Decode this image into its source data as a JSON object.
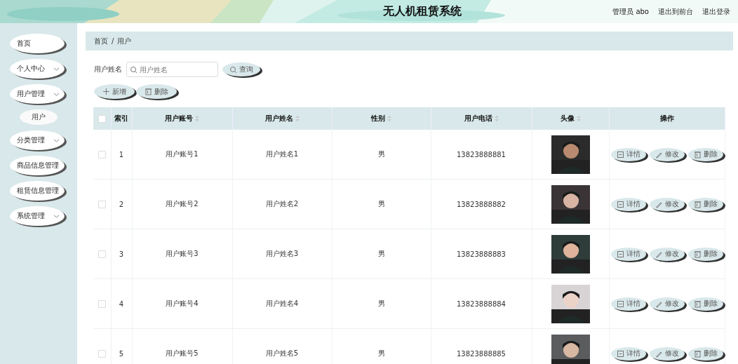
{
  "header": {
    "title": "无人机租赁系统",
    "links": [
      {
        "kind": "text",
        "label": "管理员 abo"
      },
      {
        "kind": "link",
        "label": "退出到前台"
      },
      {
        "kind": "link",
        "label": "退出登录"
      }
    ]
  },
  "sidebar": {
    "items": [
      {
        "label": "首页",
        "kind": "menu",
        "expandable": false,
        "selected": false
      },
      {
        "label": "个人中心",
        "kind": "menu",
        "expandable": true,
        "selected": false
      },
      {
        "label": "用户管理",
        "kind": "menu",
        "expandable": true,
        "selected": false
      },
      {
        "label": "用户",
        "kind": "submenu",
        "expandable": false,
        "selected": true
      },
      {
        "label": "分类管理",
        "kind": "menu",
        "expandable": true,
        "selected": false
      },
      {
        "label": "商品信息管理",
        "kind": "menu",
        "expandable": false,
        "selected": false
      },
      {
        "label": "租赁信息管理",
        "kind": "menu",
        "expandable": false,
        "selected": false
      },
      {
        "label": "系统管理",
        "kind": "menu",
        "expandable": true,
        "selected": false
      }
    ]
  },
  "breadcrumb": [
    "首页",
    "/",
    "用户"
  ],
  "search": {
    "label": "用户姓名",
    "placeholder": "用户姓名",
    "button": "查询"
  },
  "toolbar": [
    {
      "kind": "add",
      "label": "新增"
    },
    {
      "kind": "delete",
      "label": "删除"
    }
  ],
  "table": {
    "columns": [
      {
        "kind": "check",
        "checked": false
      },
      {
        "kind": "text",
        "label": "索引",
        "sortable": false
      },
      {
        "kind": "text",
        "label": "用户账号",
        "sortable": true
      },
      {
        "kind": "text",
        "label": "用户姓名",
        "sortable": true
      },
      {
        "kind": "text",
        "label": "性别",
        "sortable": true
      },
      {
        "kind": "text",
        "label": "用户电话",
        "sortable": true
      },
      {
        "kind": "text",
        "label": "头像",
        "sortable": true
      },
      {
        "kind": "text",
        "label": "操作",
        "sortable": false
      }
    ],
    "rows": [
      {
        "checked": false,
        "index": "1",
        "account": "用户账号1",
        "name": "用户姓名1",
        "gender": "男",
        "phone": "13823888881",
        "actions": [
          {
            "kind": "detail",
            "label": "详情"
          },
          {
            "kind": "edit",
            "label": "修改"
          },
          {
            "kind": "delete",
            "label": "删除"
          }
        ]
      },
      {
        "checked": false,
        "index": "2",
        "account": "用户账号2",
        "name": "用户姓名2",
        "gender": "男",
        "phone": "13823888882",
        "actions": [
          {
            "kind": "detail",
            "label": "详情"
          },
          {
            "kind": "edit",
            "label": "修改"
          },
          {
            "kind": "delete",
            "label": "删除"
          }
        ]
      },
      {
        "checked": false,
        "index": "3",
        "account": "用户账号3",
        "name": "用户姓名3",
        "gender": "男",
        "phone": "13823888883",
        "actions": [
          {
            "kind": "detail",
            "label": "详情"
          },
          {
            "kind": "edit",
            "label": "修改"
          },
          {
            "kind": "delete",
            "label": "删除"
          }
        ]
      },
      {
        "checked": false,
        "index": "4",
        "account": "用户账号4",
        "name": "用户姓名4",
        "gender": "男",
        "phone": "13823888884",
        "actions": [
          {
            "kind": "detail",
            "label": "详情"
          },
          {
            "kind": "edit",
            "label": "修改"
          },
          {
            "kind": "delete",
            "label": "删除"
          }
        ]
      },
      {
        "checked": false,
        "index": "5",
        "account": "用户账号5",
        "name": "用户姓名5",
        "gender": "男",
        "phone": "13823888885",
        "actions": [
          {
            "kind": "detail",
            "label": "详情"
          },
          {
            "kind": "edit",
            "label": "修改"
          },
          {
            "kind": "delete",
            "label": "删除"
          }
        ]
      }
    ]
  }
}
